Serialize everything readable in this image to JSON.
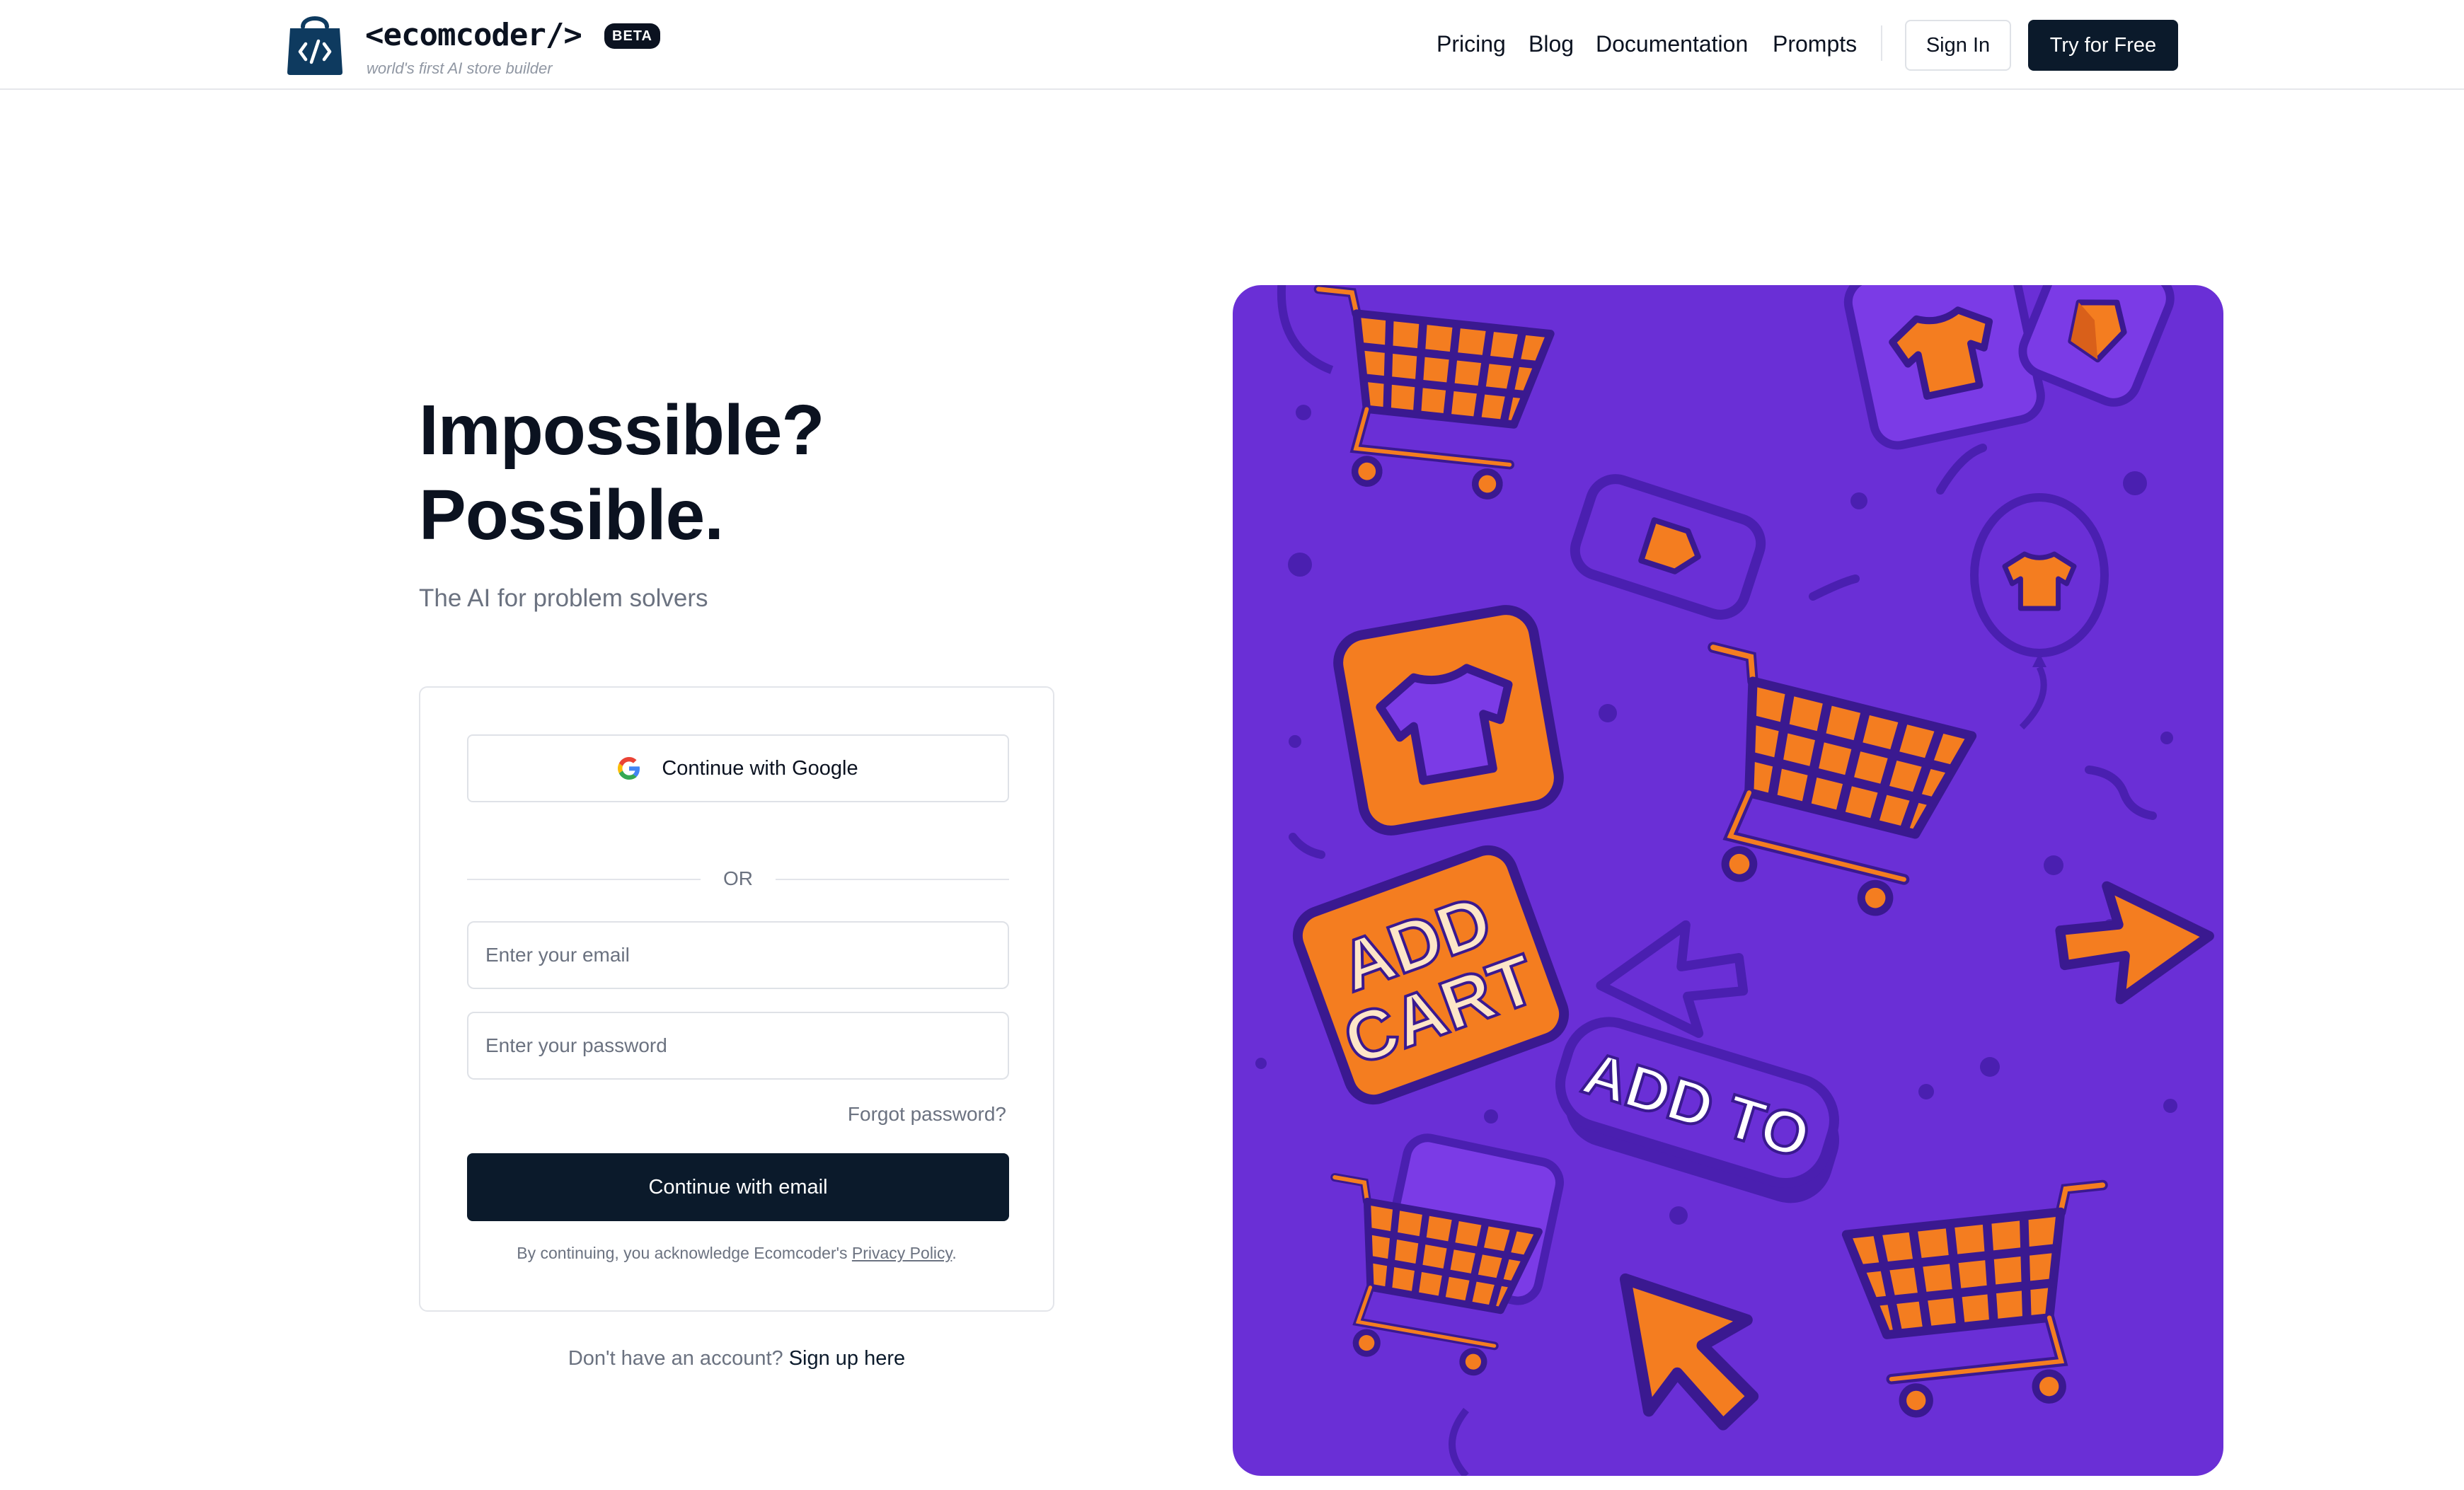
{
  "header": {
    "brand_name": "<ecomcoder/>",
    "badge": "BETA",
    "tagline": "world's first AI store builder",
    "nav": [
      "Pricing",
      "Blog",
      "Documentation",
      "Prompts"
    ],
    "signin_label": "Sign In",
    "try_label": "Try for Free"
  },
  "hero": {
    "title_line1": "Impossible?",
    "title_line2": "Possible.",
    "subtitle": "The AI for problem solvers"
  },
  "auth": {
    "google_label": "Continue with Google",
    "or_label": "OR",
    "email_placeholder": "Enter your email",
    "password_placeholder": "Enter your password",
    "forgot_label": "Forgot password?",
    "submit_label": "Continue with email",
    "legal_prefix": "By continuing, you acknowledge Ecomcoder's",
    "privacy_label": "Privacy Policy",
    "legal_suffix": ".",
    "signup_prompt": "Don't have an account?",
    "signup_link": "Sign up here"
  },
  "illustration": {
    "stickers": [
      "ADD",
      "CART",
      "ADD TO"
    ]
  },
  "colors": {
    "primary": "#0b1a2b",
    "purple": "#6a2fd6",
    "orange": "#f47d20",
    "muted": "#6b7280"
  }
}
